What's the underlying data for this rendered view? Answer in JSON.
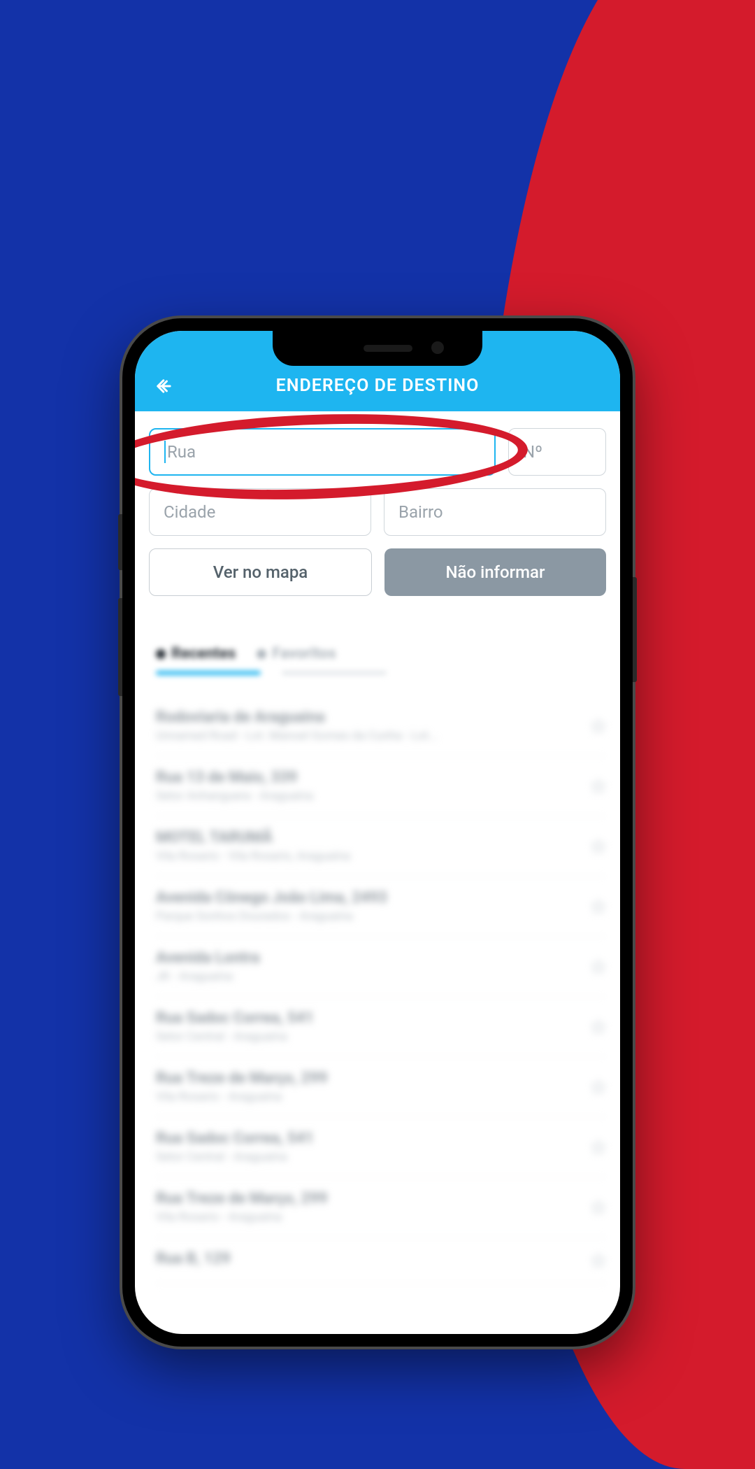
{
  "header": {
    "title": "ENDEREÇO DE DESTINO"
  },
  "form": {
    "rua_placeholder": "Rua",
    "num_placeholder": "Nº",
    "cidade_placeholder": "Cidade",
    "bairro_placeholder": "Bairro",
    "ver_mapa_label": "Ver no mapa",
    "nao_informar_label": "Não informar"
  },
  "tabs": {
    "recentes": "Recentes",
    "favoritos": "Favoritos"
  },
  "list": [
    {
      "title": "Rodoviaria de Araguaina",
      "sub": "Unnamed Road - Lot. Manoel Gomes da Cunha - Lot..."
    },
    {
      "title": "Rua 13 de Maio, 339",
      "sub": "Setor Anhanguera - Araguaína"
    },
    {
      "title": "MOTEL TARUMÃ",
      "sub": "Vila Rosario - Vila Rosario, Araguaína"
    },
    {
      "title": "Avenida Cônego João Lima, 2493",
      "sub": "Parque Sonhos Dourados - Araguaína"
    },
    {
      "title": "Avenida Lontra",
      "sub": "JK - Araguaína"
    },
    {
      "title": "Rua Sadoc Correa, 541",
      "sub": "Setor Central - Araguaína"
    },
    {
      "title": "Rua Treze de Março, 299",
      "sub": "Vila Rosario - Araguaína"
    },
    {
      "title": "Rua Sadoc Correa, 541",
      "sub": "Setor Central - Araguaína"
    },
    {
      "title": "Rua Treze de Março, 299",
      "sub": "Vila Rosario - Araguaína"
    },
    {
      "title": "Rua B, 129",
      "sub": ""
    }
  ]
}
